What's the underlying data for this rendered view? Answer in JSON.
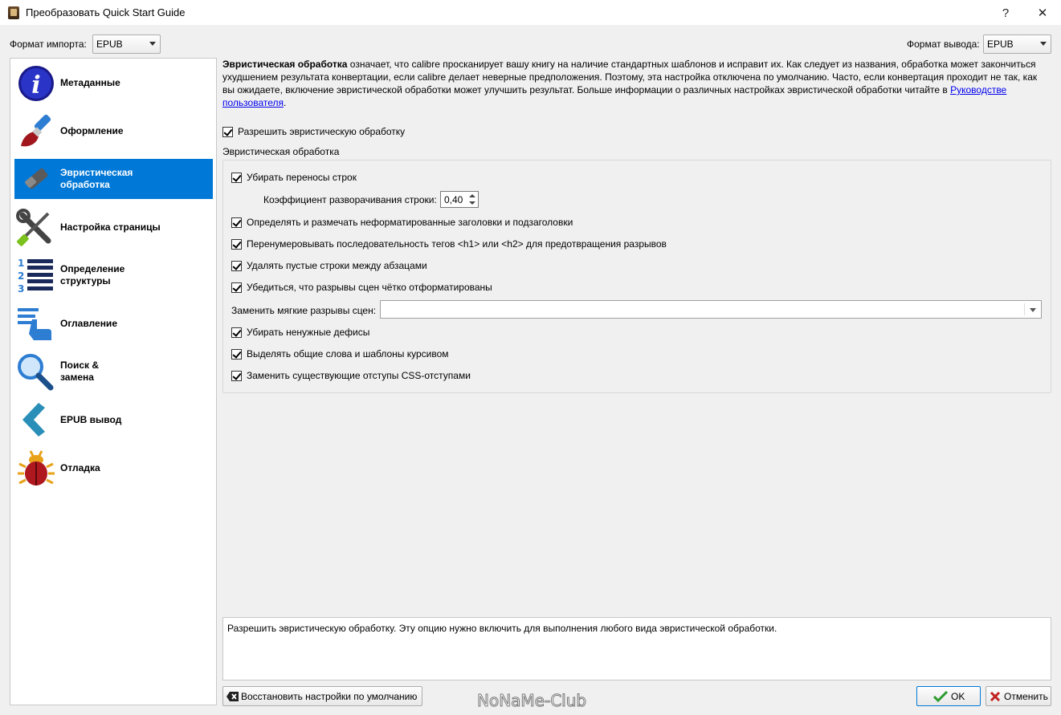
{
  "window": {
    "title": "Преобразовать Quick Start Guide",
    "help_glyph": "?",
    "close_glyph": "✕"
  },
  "formats": {
    "import_label": "Формат импорта:",
    "import_value": "EPUB",
    "output_label": "Формат вывода:",
    "output_value": "EPUB"
  },
  "sidebar": {
    "items": [
      {
        "label": "Метаданные",
        "icon": "info-icon"
      },
      {
        "label": "Оформление",
        "icon": "brush-icon"
      },
      {
        "label": "Эвристическая\nобработка",
        "icon": "eraser-icon"
      },
      {
        "label": "Настройка страницы",
        "icon": "tools-icon"
      },
      {
        "label": "Определение\nструктуры",
        "icon": "numbered-list-icon"
      },
      {
        "label": "Оглавление",
        "icon": "toc-icon"
      },
      {
        "label": "Поиск &\nзамена",
        "icon": "magnifier-icon"
      },
      {
        "label": "EPUB вывод",
        "icon": "chevron-left-icon"
      },
      {
        "label": "Отладка",
        "icon": "bug-icon"
      }
    ]
  },
  "description": {
    "bold": "Эвристическая обработка",
    "text": " означает, что calibre просканирует вашу книгу на наличие стандартных шаблонов и исправит их. Как следует из названия, обработка может закончиться ухудшением результата конвертации, если calibre делает неверные предположения. Поэтому, эта настройка отключена по умолчанию. Часто, если конвертация проходит не так, как вы ожидаете, включение эвристической обработки может улучшить результат. Больше информации о различных настройках эвристической обработки читайте в ",
    "link": "Руководстве пользователя",
    "tail": "."
  },
  "enable_heuristics": {
    "label": "Разрешить эвристическую обработку",
    "checked": true
  },
  "group_title": "Эвристическая обработка",
  "options": {
    "unwrap_lines": {
      "label": "Убирать переносы строк",
      "checked": true
    },
    "unwrap_factor_label": "Коэффициент разворачивания строки:",
    "unwrap_factor_value": "0,40",
    "markup_headings": {
      "label": "Определять и размечать неформатированные заголовки и подзаголовки",
      "checked": true
    },
    "renumber_headings": {
      "label": "Перенумеровывать последовательность тегов <h1> или <h2> для предотвращения разрывов",
      "checked": true
    },
    "delete_blank_paragraphs": {
      "label": "Удалять пустые строки между абзацами",
      "checked": true
    },
    "format_scene_breaks": {
      "label": "Убедиться, что разрывы сцен чётко отформатированы",
      "checked": true
    },
    "replace_scene_breaks_label": "Заменить мягкие разрывы сцен:",
    "replace_scene_breaks_value": "",
    "dehyphenate": {
      "label": "Убирать ненужные дефисы",
      "checked": true
    },
    "italicize_common": {
      "label": "Выделять общие слова и шаблоны курсивом",
      "checked": true
    },
    "fix_indents": {
      "label": "Заменить существующие отступы CSS-отступами",
      "checked": true
    }
  },
  "help_text": "Разрешить эвристическую обработку. Эту опцию нужно включить для выполнения любого вида эвристической обработки.",
  "buttons": {
    "restore_defaults": "Восстановить настройки по умолчанию",
    "ok": "OK",
    "cancel": "Отменить"
  },
  "watermark": "NoNaMe-Club",
  "colors": {
    "accent": "#0078d7",
    "link": "#0000ee",
    "ok_green": "#2e9b2e",
    "cancel_red": "#c02020"
  }
}
